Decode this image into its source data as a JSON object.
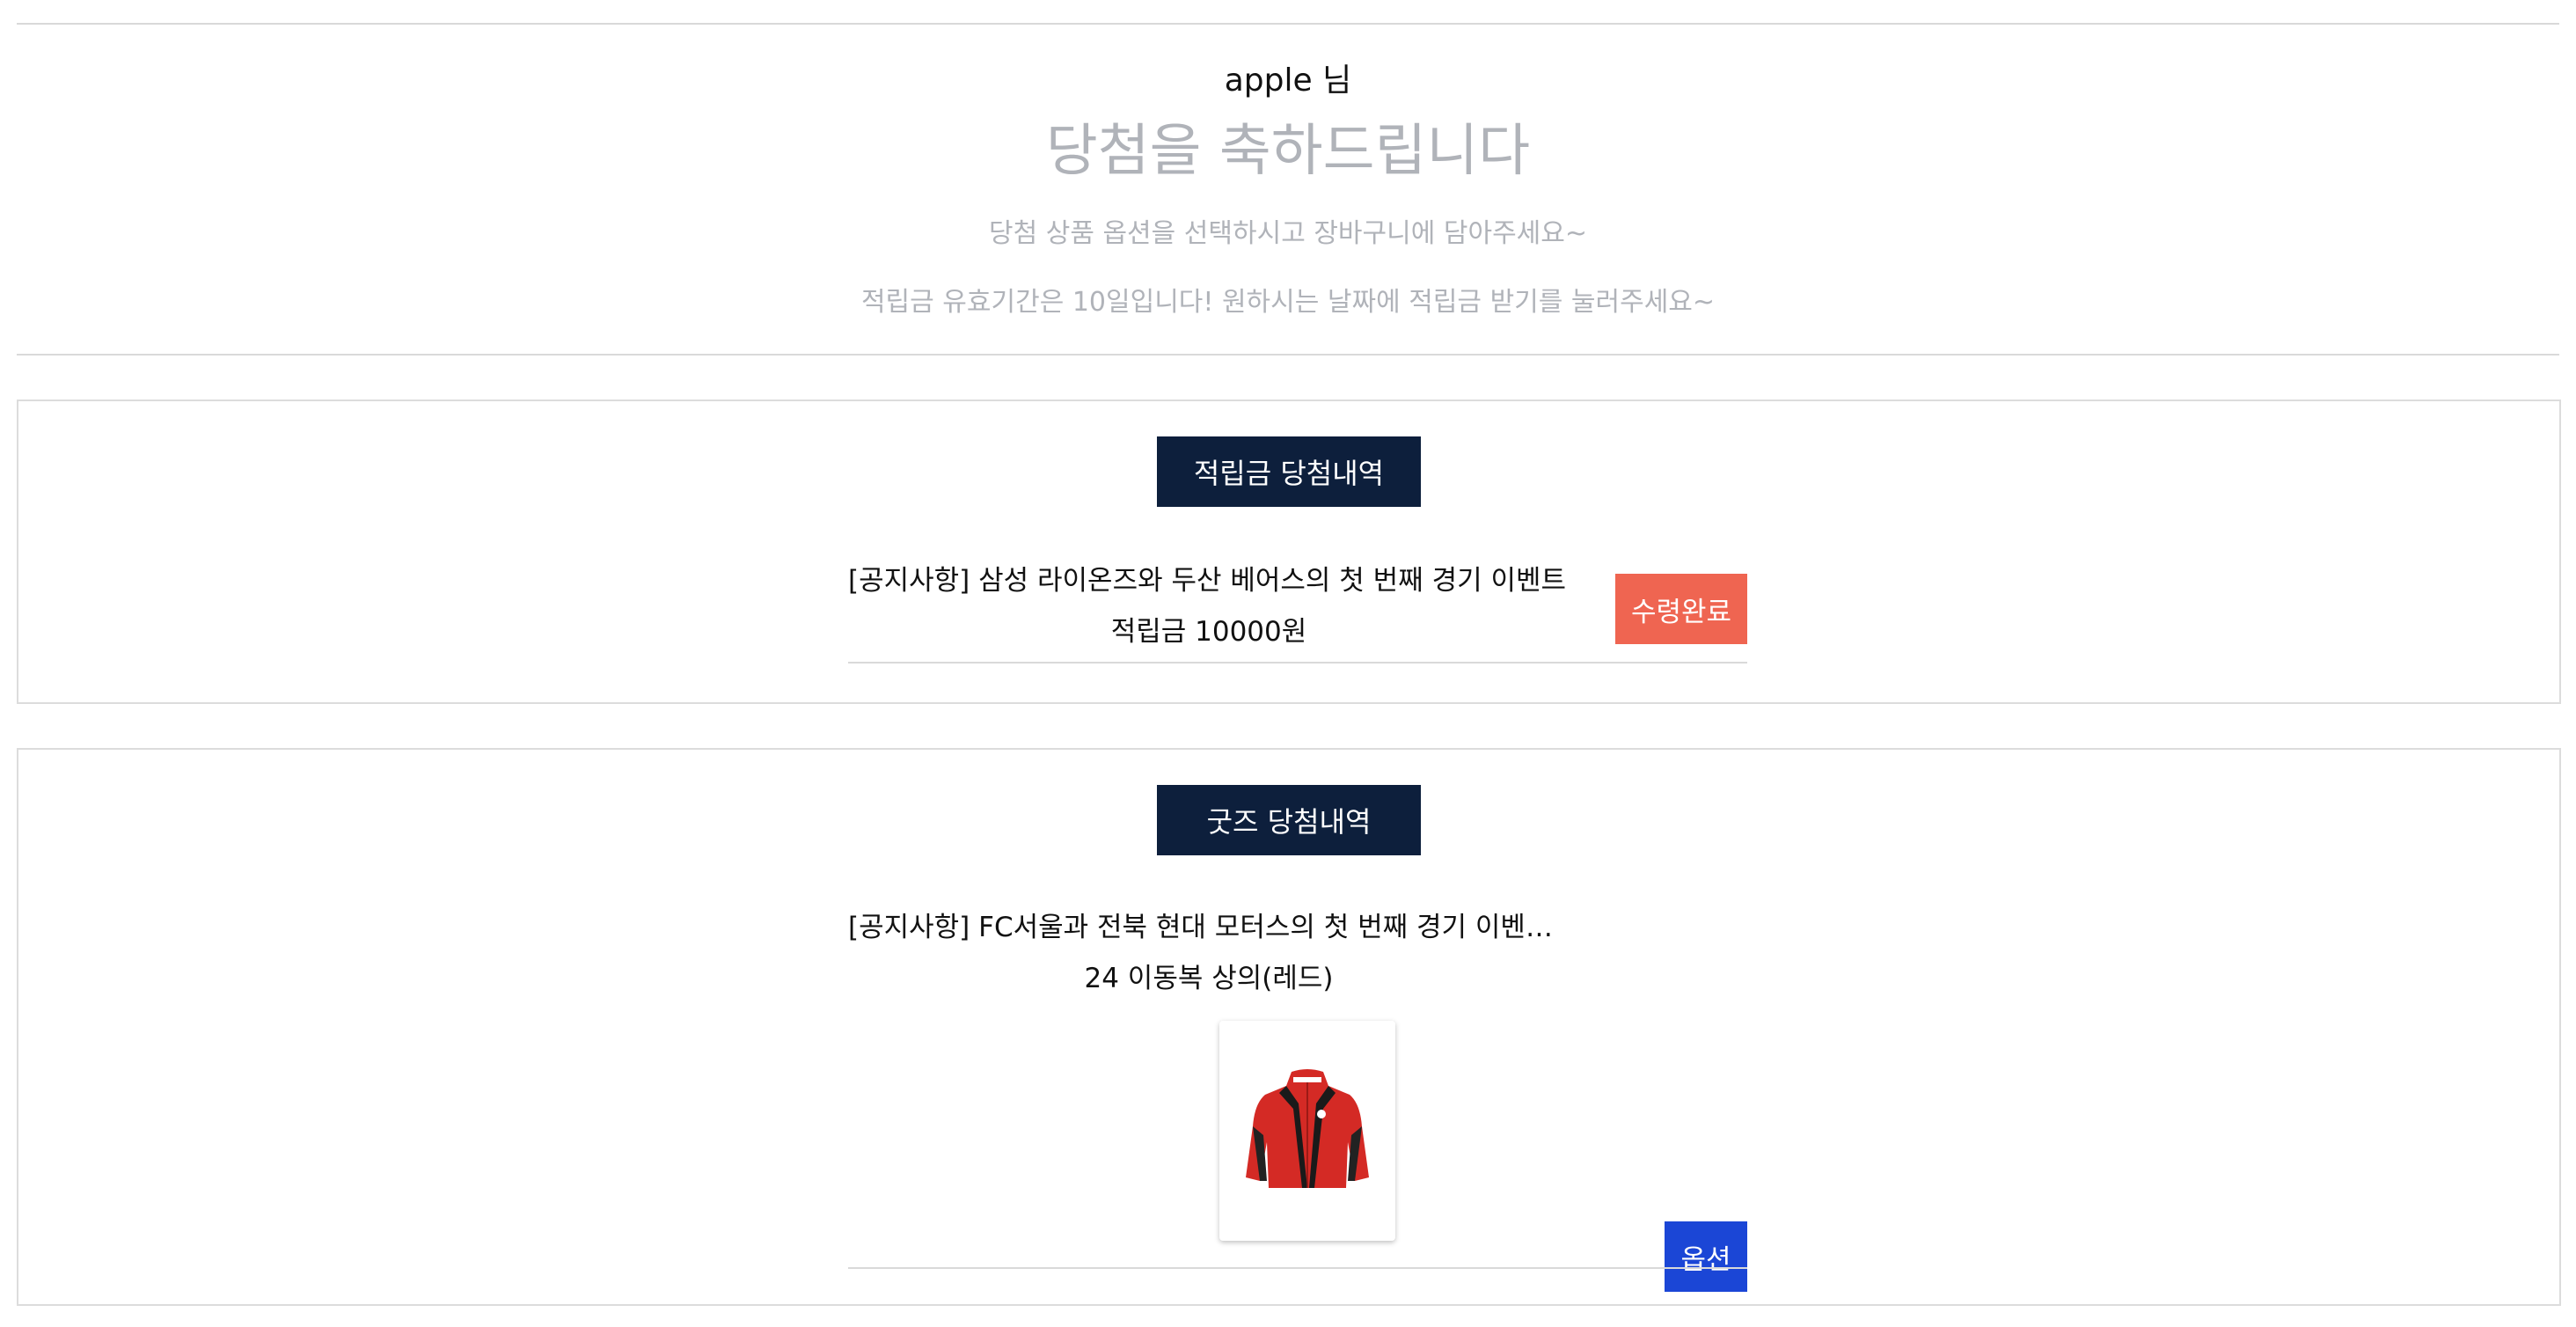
{
  "header": {
    "user_greeting": "apple 님",
    "title": "당첨을 축하드립니다",
    "instruction_1": "당첨 상품 옵션을 선택하시고 장바구니에 담아주세요~",
    "instruction_2": "적립금 유효기간은 10일입니다! 원하시는 날짜에 적립금 받기를 눌러주세요~"
  },
  "points_section": {
    "heading": "적립금 당첨내역",
    "items": [
      {
        "title": "[공지사항] 삼성 라이온즈와 두산 베어스의 첫 번째 경기 이벤트",
        "reward": "적립금 10000원",
        "button_label": "수령완료"
      }
    ]
  },
  "goods_section": {
    "heading": "굿즈 당첨내역",
    "items": [
      {
        "title": "[공지사항] FC서울과 전북 현대 모터스의 첫 번째 경기 이벤트 안내",
        "product": "24 이동복 상의(레드)",
        "image": "red-jacket-product-image",
        "button_label": "옵션"
      }
    ]
  },
  "colors": {
    "navy": "#0d1f3c",
    "received_button": "#ef6551",
    "option_button": "#1b46d6",
    "muted_text": "#b0b3b9"
  }
}
